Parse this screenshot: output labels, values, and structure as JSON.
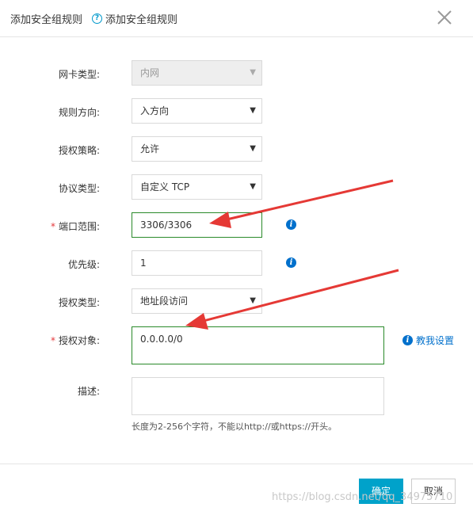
{
  "header": {
    "title": "添加安全组规则",
    "help_label": "添加安全组规则"
  },
  "form": {
    "nic_type": {
      "label": "网卡类型:",
      "value": "内网",
      "disabled": true
    },
    "direction": {
      "label": "规则方向:",
      "value": "入方向"
    },
    "policy": {
      "label": "授权策略:",
      "value": "允许"
    },
    "protocol": {
      "label": "协议类型:",
      "value": "自定义 TCP"
    },
    "port_range": {
      "label": "端口范围:",
      "value": "3306/3306",
      "required": true
    },
    "priority": {
      "label": "优先级:",
      "value": "1"
    },
    "auth_type": {
      "label": "授权类型:",
      "value": "地址段访问"
    },
    "auth_object": {
      "label": "授权对象:",
      "value": "0.0.0.0/0",
      "required": true,
      "help_link": "教我设置"
    },
    "description": {
      "label": "描述:",
      "value": "",
      "hint": "长度为2-256个字符，不能以http://或https://开头。"
    }
  },
  "footer": {
    "confirm_label": "确定",
    "cancel_label": "取消"
  },
  "watermark": "https://blog.csdn.net/qq_34975710",
  "colors": {
    "primary": "#00a2ca",
    "link": "#0070cc",
    "required": "#e4393c",
    "annotation_arrow": "#e53935"
  }
}
